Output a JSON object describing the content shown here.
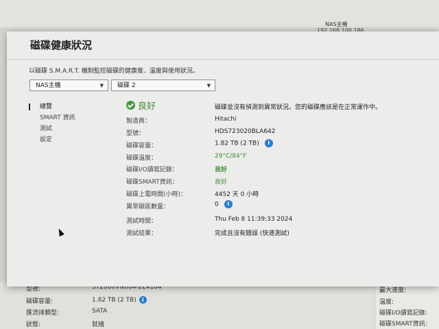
{
  "background": {
    "nas_name": "NAS主機",
    "nas_ip": "192.168.100.186",
    "rows": [
      {
        "label": "型號:",
        "value": "ST2000VN004-2E4164"
      },
      {
        "label": "磁碟容量:",
        "value": "1.82 TB (2 TB)"
      },
      {
        "label": "匯流排類型:",
        "value": "SATA"
      },
      {
        "label": "狀態:",
        "value": "就緒"
      }
    ],
    "right_rows": [
      "最大速度:",
      "溫度:",
      "磁碟I/O讀寫記錄:",
      "磁碟SMART資訊:"
    ]
  },
  "modal": {
    "title": "磁碟健康狀況",
    "description": "以磁碟 S.M.A.R.T. 機制監控磁碟的健康度、溫度與使用狀況。",
    "device_select": "NAS主機",
    "disk_select": "磁碟 2",
    "nav": [
      "總覽",
      "SMART 資訊",
      "測試",
      "設定"
    ],
    "status": {
      "label": "良好",
      "message": "磁碟並沒有偵測到異常狀況。您的磁碟應該是在正常運作中。"
    },
    "fields": [
      {
        "label": "製造商：",
        "value": "Hitachi"
      },
      {
        "label": "型號：",
        "value": "HDS723020BLA642"
      },
      {
        "label": "磁碟容量：",
        "value": "1.82 TB (2 TB)"
      },
      {
        "label": "磁碟溫度：",
        "value": "29°C/84°F"
      },
      {
        "label": "磁碟I/O讀寫記錄：",
        "value": "良好"
      },
      {
        "label": "磁碟SMART資訊：",
        "value": "良好"
      },
      {
        "label": "磁碟上電時間(小時)：",
        "value": "4452 天 0 小時"
      },
      {
        "label": "異常磁區數量：",
        "value": "0"
      },
      {
        "label": "測試時間：",
        "value": "Thu Feb 8 11:39:33 2024"
      },
      {
        "label": "測試結果：",
        "value": "完成且沒有錯誤 (快速測試)"
      }
    ],
    "info_glyph": "i"
  }
}
